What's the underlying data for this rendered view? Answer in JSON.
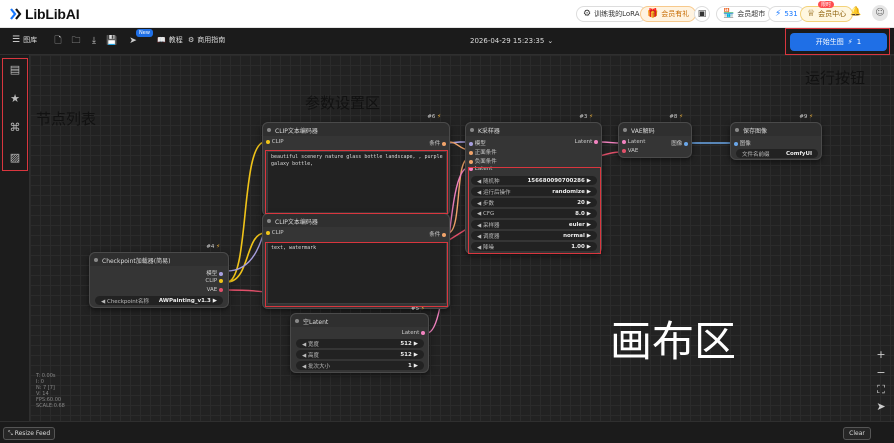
{
  "topbar": {
    "logo_text": "LibLibAI",
    "train_lora": "训练我的LoRA",
    "recharge": "会员有礼",
    "member_market": "会员超市",
    "credits": "531",
    "member_center": "会员中心",
    "member_badge": "限时"
  },
  "toolbar": {
    "library": "图库",
    "new_badge": "New",
    "tutorial": "教程",
    "business": "商用指南",
    "timestamp": "2026-04-29 15:23:35",
    "run_label": "开始生图",
    "run_count": "1"
  },
  "annotations": {
    "node_list": "节点列表",
    "params_area": "参数设置区",
    "run_button": "运行按钮",
    "canvas_area": "画布区"
  },
  "nodes": {
    "checkpoint": {
      "id": "#4",
      "title": "Checkpoint加载器(简易)",
      "out_model": "模型",
      "out_clip": "CLIP",
      "out_vae": "VAE",
      "widget_label": "Checkpoint名称",
      "widget_value": "AWPainting_v1.3"
    },
    "clip_pos": {
      "id": "#6",
      "title": "CLIP文本编码器",
      "in_clip": "CLIP",
      "out_cond": "条件",
      "text": "beautiful scenery nature glass bottle landscape, , purple galaxy bottle,"
    },
    "clip_neg": {
      "id": "#7",
      "title": "CLIP文本编码器",
      "in_clip": "CLIP",
      "out_cond": "条件",
      "text": "text, watermark",
      "footer_id": "#5"
    },
    "ksampler": {
      "id": "#3",
      "title": "K采样器",
      "in_model": "模型",
      "in_pos": "正面条件",
      "in_neg": "负面条件",
      "in_latent": "Latent",
      "out_latent": "Latent",
      "widgets": [
        {
          "label": "随机种",
          "value": "156680090700286"
        },
        {
          "label": "运行后操作",
          "value": "randomize"
        },
        {
          "label": "步数",
          "value": "20"
        },
        {
          "label": "CFG",
          "value": "8.0"
        },
        {
          "label": "采样器",
          "value": "euler"
        },
        {
          "label": "调度器",
          "value": "normal"
        },
        {
          "label": "降噪",
          "value": "1.00"
        }
      ]
    },
    "vae_decode": {
      "id": "#8",
      "title": "VAE解码",
      "in_latent": "Latent",
      "in_vae": "VAE",
      "out_image": "图像"
    },
    "save_image": {
      "id": "#9",
      "title": "保存图像",
      "in_image": "图像",
      "widget_label": "文件名前缀",
      "widget_value": "ComfyUI"
    },
    "empty_latent": {
      "title": "空Latent",
      "out_latent": "Latent",
      "widgets": [
        {
          "label": "宽度",
          "value": "512"
        },
        {
          "label": "高度",
          "value": "512"
        },
        {
          "label": "批次大小",
          "value": "1"
        }
      ]
    }
  },
  "stats": [
    "T: 0.00s",
    "I: 0",
    "N: 7 [7]",
    "V: 14",
    "FPS:60.00",
    "SCALE:0.68"
  ],
  "bottombar": {
    "resize_feed": "Resize Feed",
    "clear": "Clear"
  },
  "colors": {
    "accent": "#1f6fe6",
    "annotation_box": "#d9363e",
    "link_clip": "#f0c419",
    "link_model": "#a8a0e0",
    "link_cond": "#f0a36a",
    "link_latent": "#f283c0",
    "link_vae": "#e2506a",
    "link_image": "#6aa6e8"
  }
}
